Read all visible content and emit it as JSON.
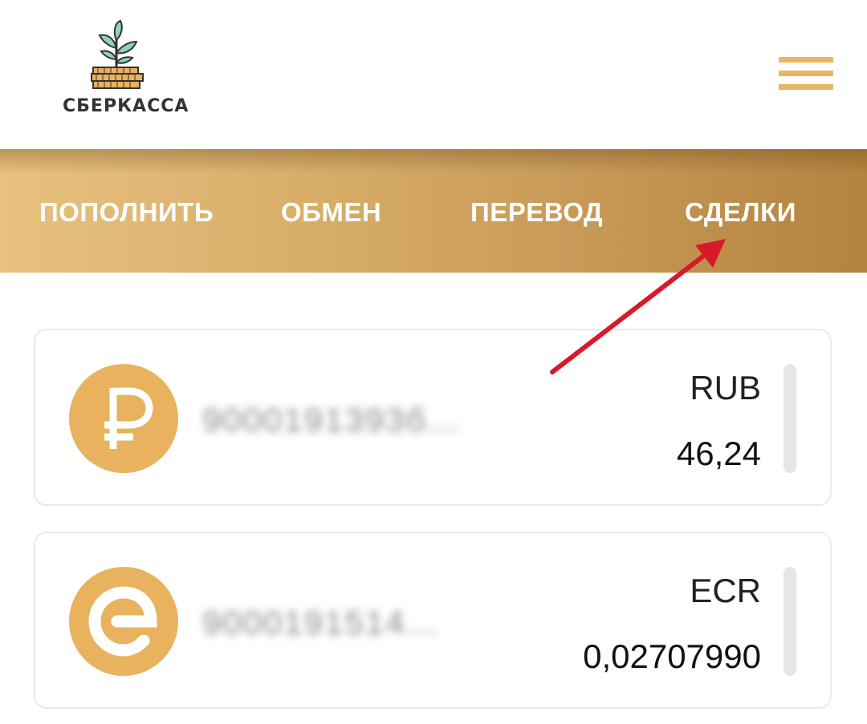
{
  "header": {
    "logo_text": "СБЕРКАССА",
    "menu_icon": "hamburger-menu-icon"
  },
  "nav": {
    "items": [
      {
        "label": "ПОПОЛНИТЬ"
      },
      {
        "label": "ОБМЕН"
      },
      {
        "label": "ПЕРЕВОД"
      },
      {
        "label": "СДЕЛКИ"
      }
    ]
  },
  "accounts": [
    {
      "icon": "ruble-coin-icon",
      "number": "9000191393б...",
      "currency": "RUB",
      "balance": "46,24"
    },
    {
      "icon": "ecr-coin-icon",
      "number": "9000191514...",
      "currency": "ECR",
      "balance": "0,02707990"
    }
  ],
  "colors": {
    "accent": "#e8b25e",
    "nav_gradient_start": "#e8c17f",
    "nav_gradient_end": "#b3833f",
    "annotation_arrow": "#d7192a"
  }
}
